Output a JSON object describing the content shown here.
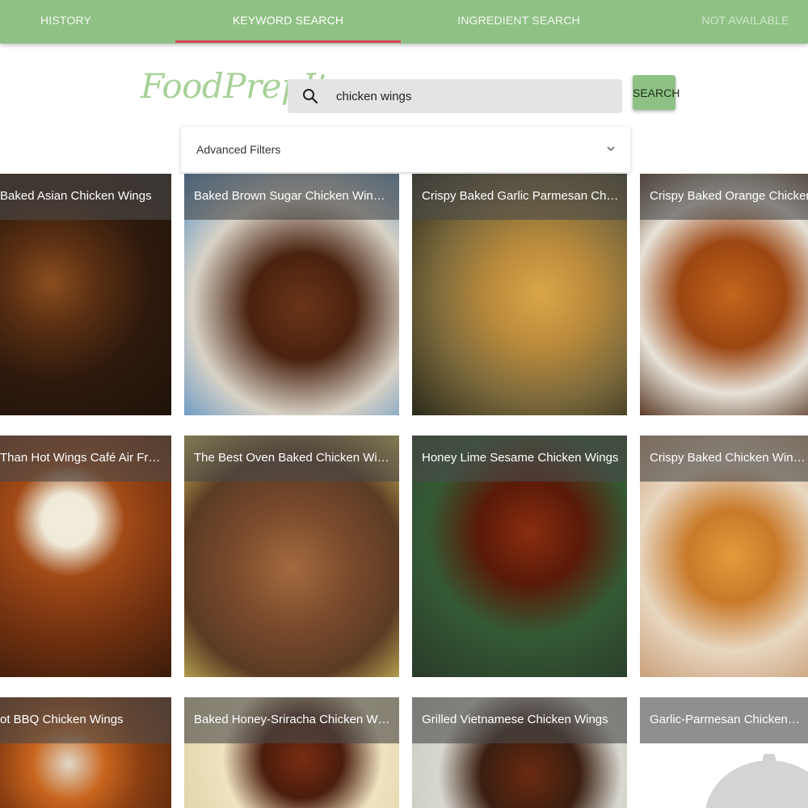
{
  "nav": {
    "tabs": [
      {
        "label": "HISTORY"
      },
      {
        "label": "KEYWORD SEARCH"
      },
      {
        "label": "INGREDIENT SEARCH"
      },
      {
        "label": "NOT AVAILABLE"
      }
    ],
    "active_tab": "KEYWORD SEARCH"
  },
  "brand": {
    "logo": "FoodPrepIt"
  },
  "search": {
    "value": "chicken wings",
    "icon": "search-icon",
    "button_label": "SEARCH"
  },
  "filters": {
    "label": "Advanced Filters",
    "expanded": false,
    "icon": "chevron-down-icon"
  },
  "colors": {
    "nav": "#8fc185",
    "indicator": "#e0435a",
    "logo": "#a7d198"
  },
  "recipes": [
    {
      "title": "Baked Asian Chicken Wings"
    },
    {
      "title": "Baked Brown Sugar Chicken Wings with ..."
    },
    {
      "title": "Crispy Baked Garlic Parmesan Chicken ..."
    },
    {
      "title": "Crispy Baked Orange Chicken Wings"
    },
    {
      "title": "Than Hot Wings Café Air Fryer Buf..."
    },
    {
      "title": "The Best Oven Baked Chicken Wings"
    },
    {
      "title": "Honey Lime Sesame Chicken Wings"
    },
    {
      "title": "Crispy Baked Chicken Wings (yup..."
    },
    {
      "title": "ot BBQ Chicken Wings"
    },
    {
      "title": "Baked Honey-Sriracha Chicken Wings"
    },
    {
      "title": "Grilled Vietnamese Chicken Wings"
    },
    {
      "title": "Garlic-Parmesan Chicken Wings"
    }
  ]
}
